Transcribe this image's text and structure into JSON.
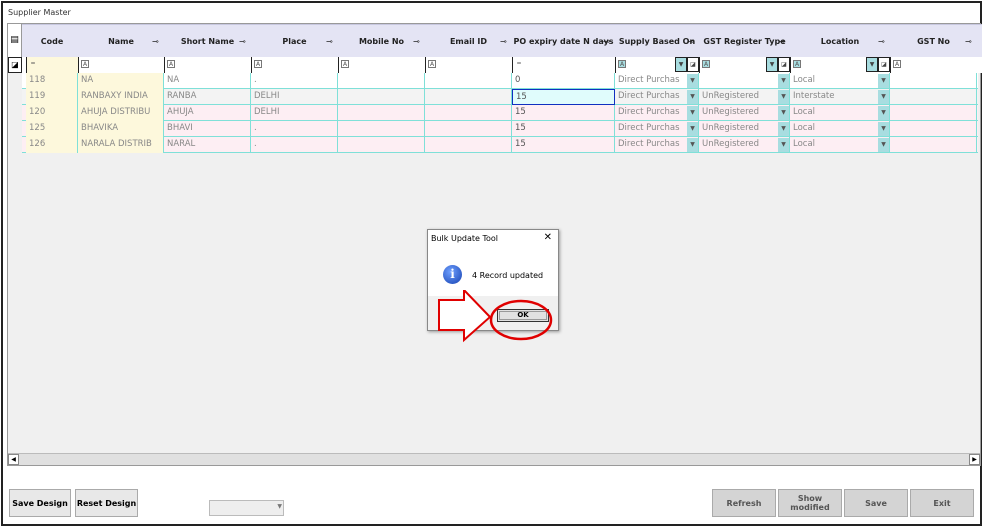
{
  "window": {
    "title": "Supplier Master"
  },
  "columns": [
    "Code",
    "Name",
    "Short Name",
    "Place",
    "Mobile No",
    "Email ID",
    "PO expiry date N days",
    "Supply Based On",
    "GST Register Type",
    "Location",
    "GST No"
  ],
  "filter": {
    "numeric_symbol": "=",
    "text_symbol": "A"
  },
  "rows": [
    {
      "code": "118",
      "name": "NA",
      "short": "NA",
      "place": ".",
      "mobile": "",
      "email": "",
      "po": "0",
      "supply": "Direct Purchas",
      "gst": "",
      "location": "Local",
      "gstno": ""
    },
    {
      "code": "119",
      "name": "RANBAXY INDIA",
      "short": "RANBA",
      "place": "DELHI",
      "mobile": "",
      "email": "",
      "po": "15",
      "supply": "Direct Purchas",
      "gst": "UnRegistered",
      "location": "Interstate",
      "gstno": ""
    },
    {
      "code": "120",
      "name": "AHUJA DISTRIBU",
      "short": "AHUJA",
      "place": "DELHI",
      "mobile": "",
      "email": "",
      "po": "15",
      "supply": "Direct Purchas",
      "gst": "UnRegistered",
      "location": "Local",
      "gstno": ""
    },
    {
      "code": "125",
      "name": "BHAVIKA",
      "short": "BHAVI",
      "place": ".",
      "mobile": "",
      "email": "",
      "po": "15",
      "supply": "Direct Purchas",
      "gst": "UnRegistered",
      "location": "Local",
      "gstno": ""
    },
    {
      "code": "126",
      "name": "NARALA DISTRIB",
      "short": "NARAL",
      "place": ".",
      "mobile": "",
      "email": "",
      "po": "15",
      "supply": "Direct Purchas",
      "gst": "UnRegistered",
      "location": "Local",
      "gstno": ""
    }
  ],
  "dialog": {
    "title": "Bulk Update Tool",
    "message": "4 Record updated",
    "ok": "OK",
    "close": "✕"
  },
  "buttons": {
    "save_design": "Save Design",
    "reset_design": "Reset Design",
    "refresh": "Refresh",
    "show_modified": "Show modified",
    "save": "Save",
    "exit": "Exit"
  },
  "colors": {
    "header": "#e4e4f4",
    "code_col": "#fdf8dc",
    "pink_row": "#fdeef3",
    "annotation": "#e00000"
  }
}
